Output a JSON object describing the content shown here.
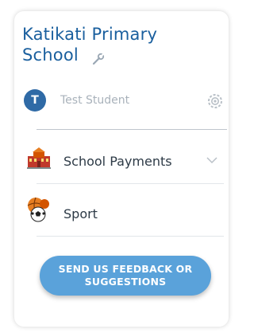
{
  "school": {
    "name": "Katikati Primary School"
  },
  "student": {
    "initial": "T",
    "name": "Test Student"
  },
  "menu": {
    "items": [
      {
        "label": "School Payments",
        "icon": "school-building-icon",
        "has_dropdown": true
      },
      {
        "label": "Sport",
        "icon": "sport-balls-icon",
        "has_dropdown": false
      }
    ]
  },
  "feedback": {
    "label": "SEND US FEEDBACK OR SUGGESTIONS"
  },
  "colors": {
    "title": "#1a5f9e",
    "button": "#5aa2da",
    "avatar": "#2f6aa6"
  }
}
